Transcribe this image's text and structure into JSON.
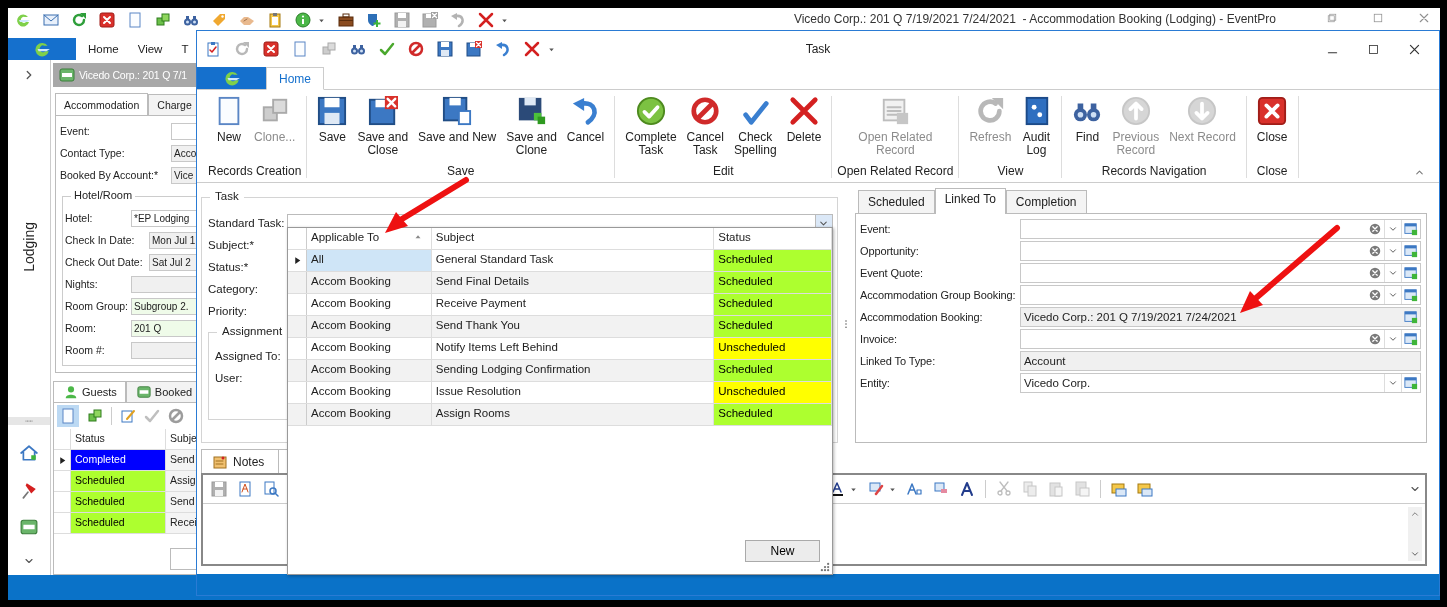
{
  "main_window": {
    "title": "Vicedo Corp.: 201 Q 7/19/2021 7/24/2021  - Accommodation Booking (Lodging) - EventPro",
    "ribbon_tabs": [
      "Home",
      "View",
      "T"
    ],
    "sidebar": {
      "title": "Lodging"
    },
    "record_header": "Vicedo Corp.: 201 Q 7/1",
    "tabs": [
      {
        "label": "Accommodation",
        "selected": true
      },
      {
        "label": "Charge",
        "selected": false
      }
    ],
    "fields": [
      {
        "label": "Event:",
        "kind": "text"
      },
      {
        "label": "Contact Type:",
        "kind": "readonly",
        "value": "Acco"
      },
      {
        "label": "Booked By Account:*",
        "kind": "readonly",
        "value": "Vice"
      }
    ],
    "hotel_room": {
      "title": "Hotel/Room",
      "fields": [
        {
          "label": "Hotel:",
          "kind": "text",
          "value": "*EP Lodging"
        },
        {
          "label": "Check In Date:",
          "kind": "date",
          "value": "Mon Jul 1"
        },
        {
          "label": "Check Out Date:",
          "kind": "date",
          "value": "Sat Jul 2"
        },
        {
          "label": "Nights:",
          "kind": "readonly"
        },
        {
          "label": "Room Group:",
          "kind": "highlighted",
          "value": "Subgroup 2."
        },
        {
          "label": "Room:",
          "kind": "highlighted",
          "value": "201 Q"
        },
        {
          "label": "Room #:",
          "kind": "readonly"
        }
      ]
    },
    "sub_tabs": [
      {
        "label": "Guests",
        "selected": true
      },
      {
        "label": "Booked",
        "selected": false
      }
    ],
    "grid": {
      "columns": [
        "Status",
        "Subje"
      ],
      "rows": [
        {
          "status": "Completed",
          "color": "#0000ff",
          "subject": "Send",
          "selected": true
        },
        {
          "status": "Scheduled",
          "color": "#adff2f",
          "subject": "Assig",
          "selected": false
        },
        {
          "status": "Scheduled",
          "color": "#adff2f",
          "subject": "Send",
          "selected": false
        },
        {
          "status": "Scheduled",
          "color": "#adff2f",
          "subject": "Recei",
          "selected": false
        }
      ]
    }
  },
  "task_window": {
    "title": "Task",
    "ribbon_tab": "Home",
    "ribbon_groups": [
      {
        "label": "Records Creation",
        "buttons": [
          {
            "label": "New",
            "disabled": false
          },
          {
            "label": "Clone...",
            "disabled": true
          }
        ]
      },
      {
        "label": "Save",
        "buttons": [
          {
            "label": "Save",
            "disabled": false
          },
          {
            "label": "Save and\nClose",
            "disabled": false
          },
          {
            "label": "Save and New",
            "disabled": false
          },
          {
            "label": "Save and\nClone",
            "disabled": false
          },
          {
            "label": "Cancel",
            "disabled": false
          }
        ]
      },
      {
        "label": "Edit",
        "buttons": [
          {
            "label": "Complete\nTask",
            "disabled": false
          },
          {
            "label": "Cancel\nTask",
            "disabled": false
          },
          {
            "label": "Check\nSpelling",
            "disabled": false
          },
          {
            "label": "Delete",
            "disabled": false
          }
        ]
      },
      {
        "label": "Open Related Record",
        "buttons": [
          {
            "label": "Open Related\nRecord",
            "disabled": true
          }
        ]
      },
      {
        "label": "View",
        "buttons": [
          {
            "label": "Refresh",
            "disabled": true
          },
          {
            "label": "Audit\nLog",
            "disabled": false
          }
        ]
      },
      {
        "label": "Records Navigation",
        "buttons": [
          {
            "label": "Find",
            "disabled": false
          },
          {
            "label": "Previous\nRecord",
            "disabled": true
          },
          {
            "label": "Next Record",
            "disabled": true
          }
        ]
      },
      {
        "label": "Close",
        "buttons": [
          {
            "label": "Close",
            "disabled": false
          }
        ]
      }
    ],
    "task_group": {
      "title": "Task",
      "labels": [
        "Standard Task:",
        "Subject:*",
        "Status:*",
        "Category:",
        "Priority:"
      ],
      "assignment": {
        "title": "Assignment",
        "labels": [
          "Assigned To:",
          "User:"
        ]
      }
    },
    "standard_task_popup": {
      "columns": [
        {
          "label": "Applicable To",
          "sorted": true
        },
        {
          "label": "Subject",
          "sorted": false
        },
        {
          "label": "Status",
          "sorted": false
        }
      ],
      "rows": [
        {
          "applicable_to": "All",
          "subject": "General Standard Task",
          "status": "Scheduled",
          "color": "#adff2f",
          "selected": true
        },
        {
          "applicable_to": "Accom Booking",
          "subject": "Send Final Details",
          "status": "Scheduled",
          "color": "#adff2f",
          "selected": false
        },
        {
          "applicable_to": "Accom Booking",
          "subject": "Receive Payment",
          "status": "Scheduled",
          "color": "#adff2f",
          "selected": false
        },
        {
          "applicable_to": "Accom Booking",
          "subject": "Send Thank You",
          "status": "Scheduled",
          "color": "#adff2f",
          "selected": false
        },
        {
          "applicable_to": "Accom Booking",
          "subject": "Notify Items Left Behind",
          "status": "Unscheduled",
          "color": "#ffff00",
          "selected": false
        },
        {
          "applicable_to": "Accom Booking",
          "subject": "Sending Lodging Confirmation",
          "status": "Scheduled",
          "color": "#adff2f",
          "selected": false
        },
        {
          "applicable_to": "Accom Booking",
          "subject": "Issue Resolution",
          "status": "Unscheduled",
          "color": "#ffff00",
          "selected": false
        },
        {
          "applicable_to": "Accom Booking",
          "subject": "Assign Rooms",
          "status": "Scheduled",
          "color": "#adff2f",
          "selected": false
        }
      ],
      "button": "New"
    },
    "linked_panel": {
      "tabs": [
        {
          "label": "Scheduled",
          "selected": false
        },
        {
          "label": "Linked To",
          "selected": true
        },
        {
          "label": "Completion",
          "selected": false
        }
      ],
      "fields": [
        {
          "label": "Event:",
          "kind": "lookup"
        },
        {
          "label": "Opportunity:",
          "kind": "lookup"
        },
        {
          "label": "Event Quote:",
          "kind": "lookup"
        },
        {
          "label": "Accommodation Group Booking:",
          "kind": "lookup"
        },
        {
          "label": "Accommodation Booking:",
          "kind": "linked",
          "value": "Vicedo Corp.: 201 Q 7/19/2021 7/24/2021"
        },
        {
          "label": "Invoice:",
          "kind": "lookup"
        },
        {
          "label": "Linked To Type:",
          "kind": "readonly",
          "value": "Account"
        },
        {
          "label": "Entity:",
          "kind": "select",
          "value": "Vicedo Corp."
        }
      ]
    },
    "notes_tab": "Notes"
  }
}
